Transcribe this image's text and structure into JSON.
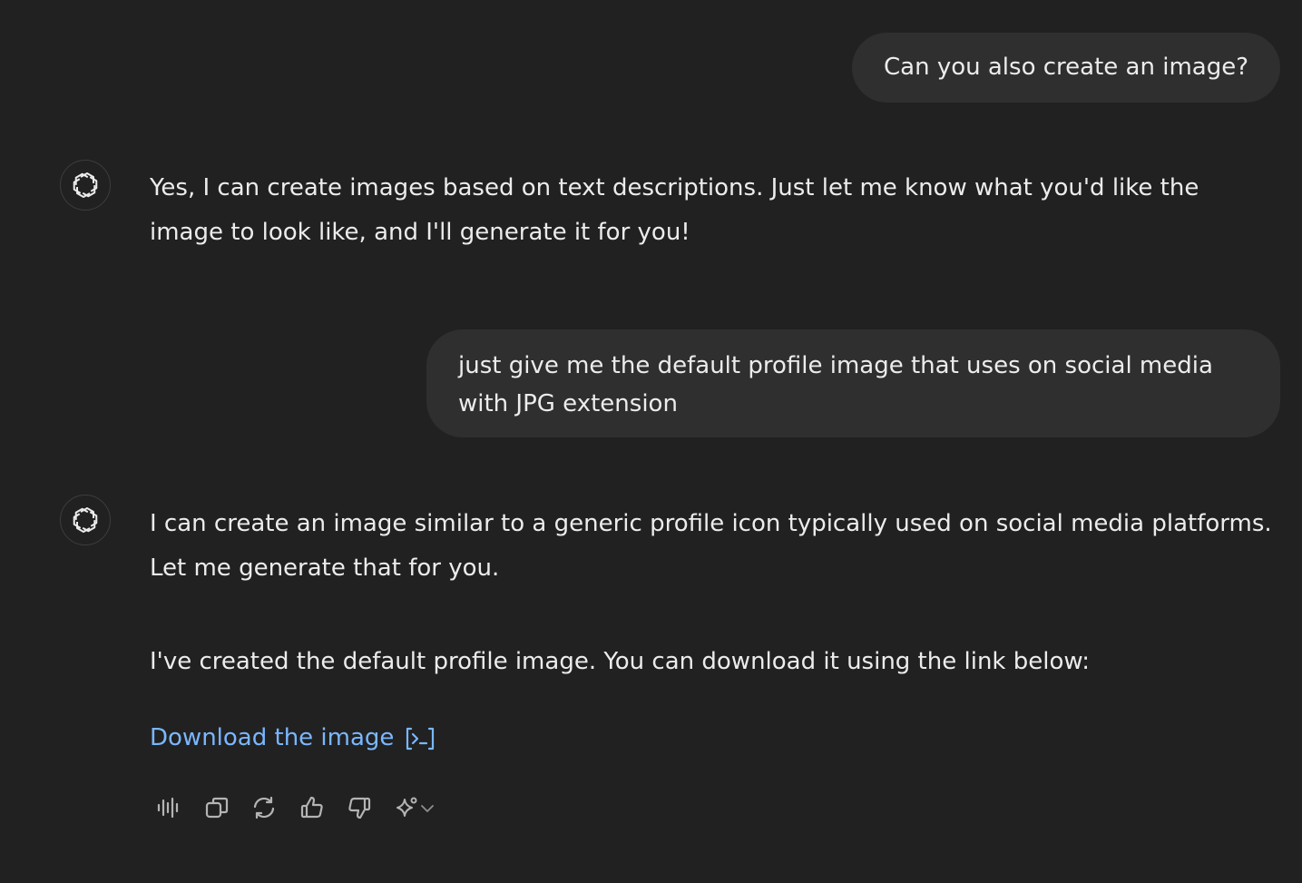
{
  "messages": {
    "user_1": "Can you also create an image?",
    "assistant_1": "Yes, I can create images based on text descriptions. Just let me know what you'd like the image to look like, and I'll generate it for you!",
    "user_2": "just give me the default profile image that uses on social media with JPG extension",
    "assistant_2_part1": "I can create an image similar to a generic profile icon typically used on social media platforms. Let me generate that for you.",
    "assistant_2_part2": "I've created the default profile image. You can download it using the link below:",
    "download_link_text": "Download the image"
  },
  "icons": {
    "assistant_avatar": "openai-logo-icon",
    "download_link": "code-interpreter-icon",
    "actions": [
      "read-aloud-icon",
      "copy-icon",
      "regenerate-icon",
      "thumbs-up-icon",
      "thumbs-down-icon",
      "sparkle-model-icon"
    ]
  },
  "colors": {
    "background": "#212121",
    "user_bubble": "#2f2f2f",
    "text": "#ececec",
    "link": "#7ab7ff",
    "icon": "#b4b4b4"
  }
}
